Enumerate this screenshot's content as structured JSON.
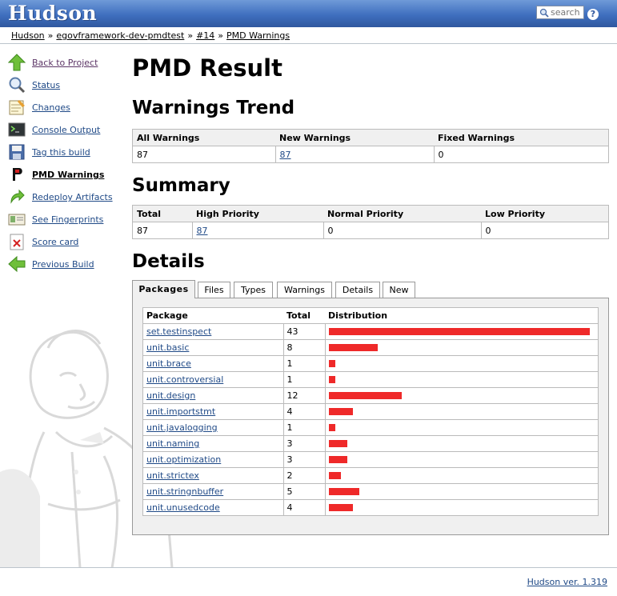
{
  "header": {
    "logo": "Hudson",
    "search_placeholder": "search",
    "help_label": "?"
  },
  "breadcrumb": {
    "items": [
      "Hudson",
      "egovframework-dev-pmdtest",
      "#14",
      "PMD Warnings"
    ],
    "separator": "»"
  },
  "sidebar": {
    "items": [
      {
        "label": "Back to Project",
        "icon": "up-arrow-icon"
      },
      {
        "label": "Status",
        "icon": "magnifier-icon"
      },
      {
        "label": "Changes",
        "icon": "notepad-icon"
      },
      {
        "label": "Console Output",
        "icon": "terminal-icon"
      },
      {
        "label": "Tag this build",
        "icon": "save-icon"
      },
      {
        "label": "PMD Warnings",
        "icon": "pmd-icon"
      },
      {
        "label": "Redeploy Artifacts",
        "icon": "redeploy-icon"
      },
      {
        "label": "See Fingerprints",
        "icon": "fingerprint-icon"
      },
      {
        "label": "Score card",
        "icon": "scorecard-icon"
      },
      {
        "label": "Previous Build",
        "icon": "left-arrow-icon"
      }
    ]
  },
  "main": {
    "title": "PMD Result",
    "trend": {
      "heading": "Warnings Trend",
      "headers": [
        "All Warnings",
        "New Warnings",
        "Fixed Warnings"
      ],
      "values": [
        "87",
        "87",
        "0"
      ]
    },
    "summary": {
      "heading": "Summary",
      "headers": [
        "Total",
        "High Priority",
        "Normal Priority",
        "Low Priority"
      ],
      "values": [
        "87",
        "87",
        "0",
        "0"
      ]
    },
    "details": {
      "heading": "Details",
      "tabs": [
        "Packages",
        "Files",
        "Types",
        "Warnings",
        "Details",
        "New"
      ],
      "active_tab": "Packages",
      "headers": [
        "Package",
        "Total",
        "Distribution"
      ],
      "rows": [
        {
          "package": "set.testinspect",
          "total": "43",
          "fraction": 1.0
        },
        {
          "package": "unit.basic",
          "total": "8",
          "fraction": 0.186
        },
        {
          "package": "unit.brace",
          "total": "1",
          "fraction": 0.023
        },
        {
          "package": "unit.controversial",
          "total": "1",
          "fraction": 0.023
        },
        {
          "package": "unit.design",
          "total": "12",
          "fraction": 0.279
        },
        {
          "package": "unit.importstmt",
          "total": "4",
          "fraction": 0.093
        },
        {
          "package": "unit.javalogging",
          "total": "1",
          "fraction": 0.023
        },
        {
          "package": "unit.naming",
          "total": "3",
          "fraction": 0.07
        },
        {
          "package": "unit.optimization",
          "total": "3",
          "fraction": 0.07
        },
        {
          "package": "unit.strictex",
          "total": "2",
          "fraction": 0.047
        },
        {
          "package": "unit.stringnbuffer",
          "total": "5",
          "fraction": 0.116
        },
        {
          "package": "unit.unusedcode",
          "total": "4",
          "fraction": 0.093
        }
      ],
      "bar_color": "#ef2929"
    }
  },
  "footer": {
    "version": "Hudson ver. 1.319"
  }
}
